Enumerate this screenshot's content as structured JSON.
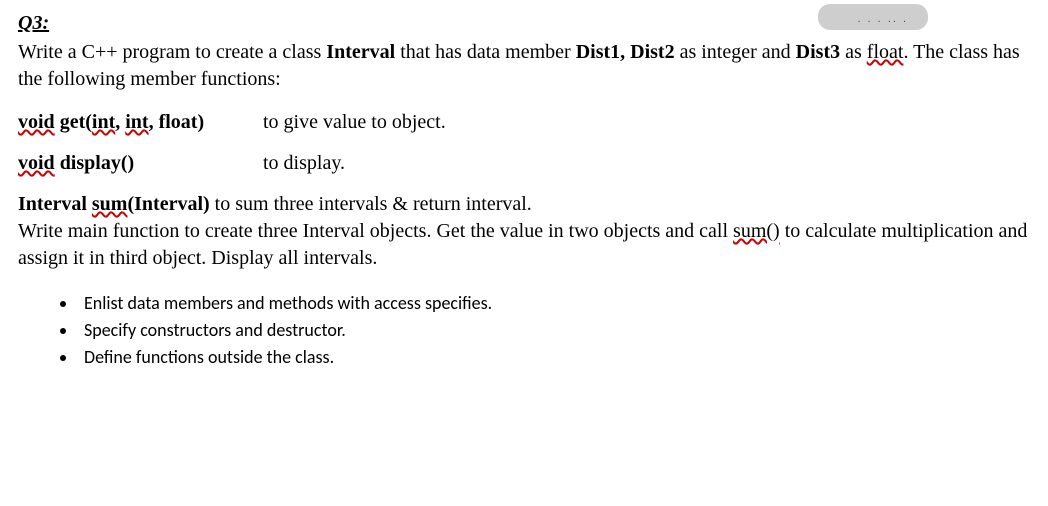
{
  "smudge_text": ". . . .. .",
  "q_label": "Q3:",
  "intro": {
    "p1a": "Write a C++ program to create a class ",
    "p1b": "Interval",
    "p1c": " that has data member ",
    "p1d": "Dist1, Dist2",
    "p1e": " as integer and ",
    "p1f": "Dist3",
    "p1g": " as ",
    "p1h": "float",
    "p1i": ". The class has the following member functions:"
  },
  "fn1": {
    "ret": "void",
    "name": " get(",
    "arg1": "int",
    "sep1": ", ",
    "arg2": "int",
    "sep2": ", float)",
    "desc": "to give value to object."
  },
  "fn2": {
    "ret": "void",
    "name": " display()",
    "desc": "to display."
  },
  "sum": {
    "t1": "Interval ",
    "t2": "sum",
    "t3": "(Interval)",
    "t4": " to sum three intervals & return interval.",
    "line2a": "Write main function to create three Interval objects. Get the value in two objects and call ",
    "line2b": "sum()",
    "line2c": " to calculate multiplication and assign it in third object. Display all intervals."
  },
  "bullets": [
    "Enlist data members and methods with access specifies.",
    "Specify constructors and destructor.",
    "Define functions outside the class."
  ]
}
